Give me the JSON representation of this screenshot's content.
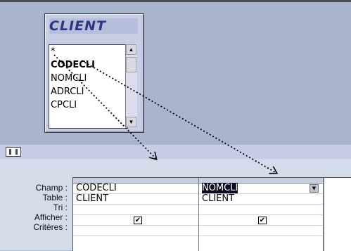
{
  "table": {
    "title": "CLIENT",
    "fields": [
      "*",
      "CODECLI",
      "NOMCLI",
      "ADRCLI",
      "CPCLI"
    ],
    "bold_field": "CODECLI"
  },
  "grid": {
    "row_labels": [
      "Champ :",
      "Table :",
      "Tri :",
      "Afficher :",
      "Critères :"
    ],
    "columns": [
      {
        "champ": "CODECLI",
        "table": "CLIENT",
        "tri": "",
        "afficher": true
      },
      {
        "champ": "NOMCLI",
        "table": "CLIENT",
        "tri": "",
        "afficher": true
      }
    ]
  },
  "icons": {
    "dropdown": "dropdown-arrow-icon",
    "checkbox": "checkmark-icon",
    "scroll_up": "scroll-up-icon",
    "scroll_down": "scroll-down-icon"
  }
}
